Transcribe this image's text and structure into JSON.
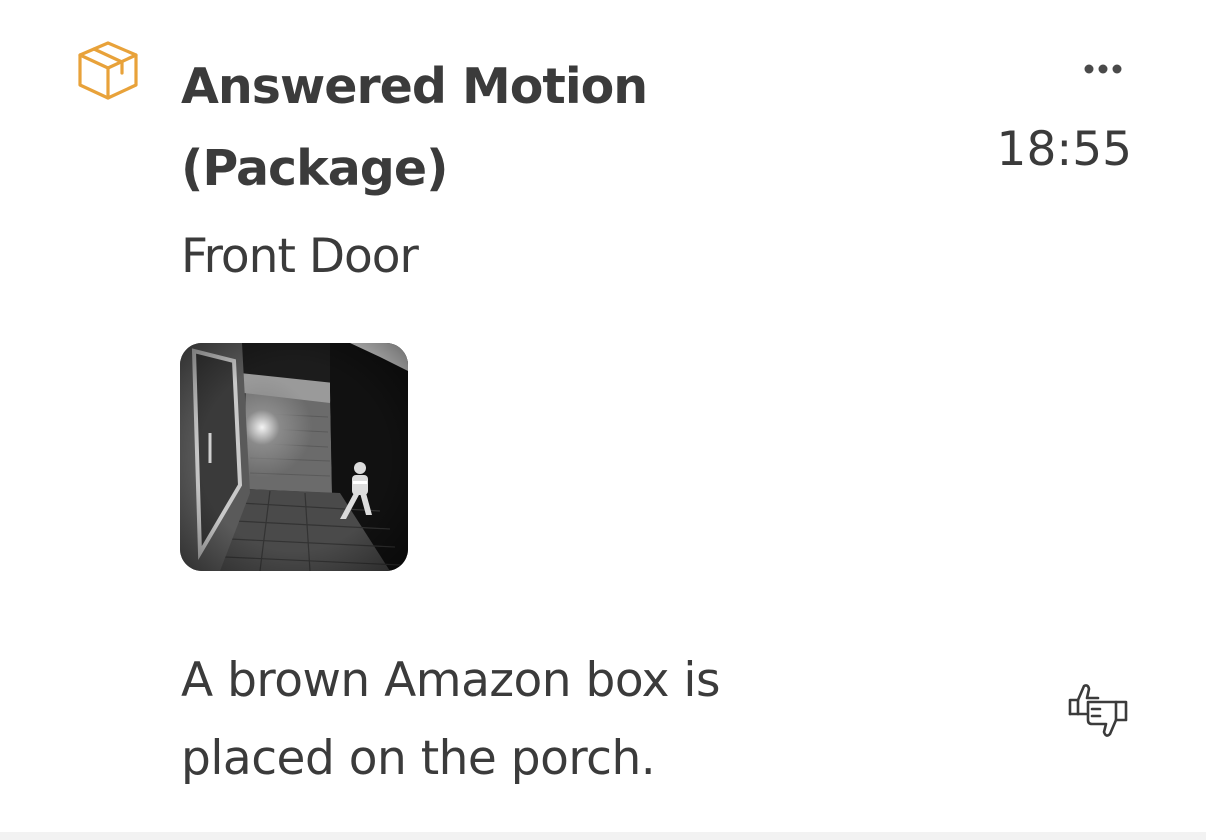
{
  "event": {
    "icon": "package-box-icon",
    "title": "Answered Motion (Package)",
    "time": "18:55",
    "device": "Front Door",
    "thumbnail": "night-porch-camera-snapshot",
    "description": "A brown Amazon box is placed on the porch.",
    "menu_icon": "more-horizontal-icon",
    "feedback_icon": "thumbs-up-down-icon"
  },
  "colors": {
    "accent": "#E8A23A",
    "text": "#3B3B3B"
  }
}
